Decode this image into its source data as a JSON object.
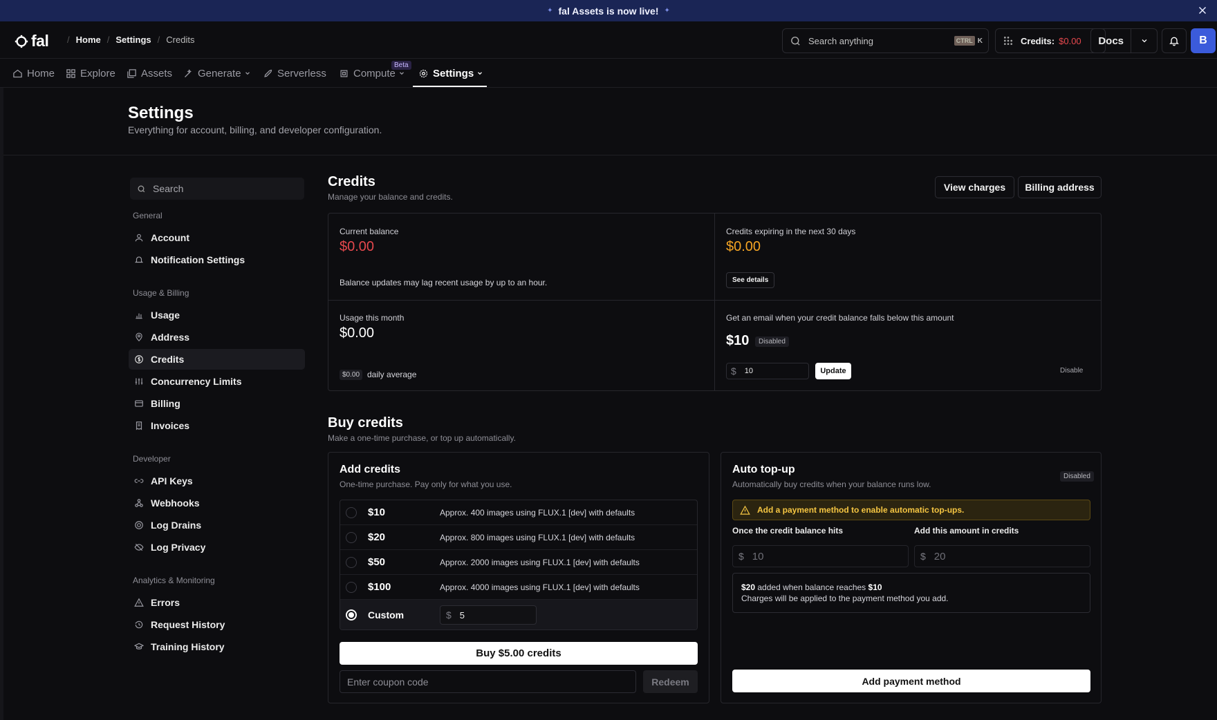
{
  "banner": {
    "text": "fal Assets is now live!"
  },
  "topbar": {
    "logo": "fal",
    "breadcrumbs": [
      "Home",
      "Settings",
      "Credits"
    ],
    "search_placeholder": "Search anything",
    "kbd_ctrl": "CTRL",
    "kbd_k": "K",
    "credits_label": "Credits:",
    "credits_value": "$0.00",
    "docs_label": "Docs",
    "avatar_letter": "B"
  },
  "nav": {
    "tabs": [
      "Home",
      "Explore",
      "Assets",
      "Generate",
      "Serverless",
      "Compute",
      "Settings"
    ],
    "beta_badge": "Beta",
    "active_tab": "Settings"
  },
  "page": {
    "title": "Settings",
    "subtitle": "Everything for account, billing, and developer configuration."
  },
  "sidebar": {
    "search_placeholder": "Search",
    "groups": [
      {
        "label": "General",
        "items": [
          "Account",
          "Notification Settings"
        ]
      },
      {
        "label": "Usage & Billing",
        "items": [
          "Usage",
          "Address",
          "Credits",
          "Concurrency Limits",
          "Billing",
          "Invoices"
        ]
      },
      {
        "label": "Developer",
        "items": [
          "API Keys",
          "Webhooks",
          "Log Drains",
          "Log Privacy"
        ]
      },
      {
        "label": "Analytics & Monitoring",
        "items": [
          "Errors",
          "Request History",
          "Training History"
        ]
      }
    ],
    "active_item": "Credits"
  },
  "credits": {
    "title": "Credits",
    "subtitle": "Manage your balance and credits.",
    "view_charges": "View charges",
    "billing_address": "Billing address",
    "current_balance_label": "Current balance",
    "current_balance": "$0.00",
    "balance_note": "Balance updates may lag recent usage by up to an hour.",
    "expiring_label": "Credits expiring in the next 30 days",
    "expiring_value": "$0.00",
    "see_details": "See details",
    "usage_label": "Usage this month",
    "usage_value": "$0.00",
    "daily_avg_value": "$0.00",
    "daily_avg_label": "daily average",
    "alert_label": "Get an email when your credit balance falls below this amount",
    "alert_value": "$10",
    "alert_status": "Disabled",
    "alert_input_value": "10",
    "update_label": "Update",
    "disable_label": "Disable"
  },
  "buy": {
    "title": "Buy credits",
    "subtitle": "Make a one-time purchase, or top up automatically.",
    "add": {
      "title": "Add credits",
      "subtitle": "One-time purchase. Pay only for what you use.",
      "options": [
        {
          "amount": "$10",
          "desc": "Approx. 400 images using FLUX.1 [dev] with defaults"
        },
        {
          "amount": "$20",
          "desc": "Approx. 800 images using FLUX.1 [dev] with defaults"
        },
        {
          "amount": "$50",
          "desc": "Approx. 2000 images using FLUX.1 [dev] with defaults"
        },
        {
          "amount": "$100",
          "desc": "Approx. 4000 images using FLUX.1 [dev] with defaults"
        }
      ],
      "custom_label": "Custom",
      "custom_value": "5",
      "buy_label": "Buy $5.00 credits",
      "coupon_placeholder": "Enter coupon code",
      "redeem_label": "Redeem"
    },
    "auto": {
      "title": "Auto top-up",
      "subtitle": "Automatically buy credits when your balance runs low.",
      "status": "Disabled",
      "warning": "Add a payment method to enable automatic top-ups.",
      "threshold_label": "Once the credit balance hits",
      "threshold_value": "10",
      "amount_label": "Add this amount in credits",
      "amount_value": "20",
      "summary_amount": "$20",
      "summary_mid": "added when balance reaches",
      "summary_threshold": "$10",
      "summary_note": "Charges will be applied to the payment method you add.",
      "add_payment_label": "Add payment method"
    }
  }
}
